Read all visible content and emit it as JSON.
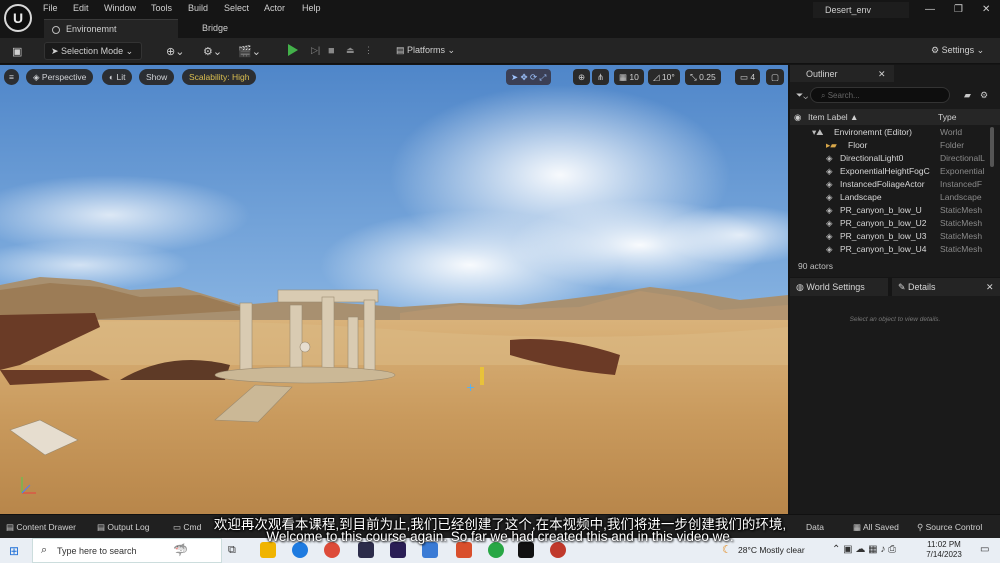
{
  "menubar": {
    "logo": "U",
    "items": [
      "File",
      "Edit",
      "Window",
      "Tools",
      "Build",
      "Select",
      "Actor",
      "Help"
    ],
    "project": "Desert_env"
  },
  "tabs": [
    {
      "label": "Environemnt"
    },
    {
      "label": "Bridge"
    }
  ],
  "toolbar": {
    "selection_mode": "Selection Mode",
    "platforms": "Platforms",
    "settings": "Settings"
  },
  "viewport": {
    "perspective": "Perspective",
    "lit": "Lit",
    "show": "Show",
    "scalability": "Scalability: High",
    "grid_snap": "10",
    "rot_snap": "10°",
    "scale_snap": "0.25",
    "cam_speed": "4"
  },
  "outliner": {
    "title": "Outliner",
    "search_placeholder": "Search...",
    "col_label": "Item Label ▲",
    "col_type": "Type",
    "rows": [
      {
        "label": "Environemnt (Editor)",
        "type": "World",
        "indent": 1
      },
      {
        "label": "Floor",
        "type": "Folder",
        "indent": 2
      },
      {
        "label": "DirectionalLight0",
        "type": "DirectionalL",
        "indent": 2
      },
      {
        "label": "ExponentialHeightFogC",
        "type": "Exponential",
        "indent": 2
      },
      {
        "label": "InstancedFoliageActor",
        "type": "InstancedF",
        "indent": 2
      },
      {
        "label": "Landscape",
        "type": "Landscape",
        "indent": 2
      },
      {
        "label": "PR_canyon_b_low_U",
        "type": "StaticMesh",
        "indent": 2
      },
      {
        "label": "PR_canyon_b_low_U2",
        "type": "StaticMesh",
        "indent": 2
      },
      {
        "label": "PR_canyon_b_low_U3",
        "type": "StaticMesh",
        "indent": 2
      },
      {
        "label": "PR_canyon_b_low_U4",
        "type": "StaticMesh",
        "indent": 2
      }
    ],
    "count": "90 actors"
  },
  "details": {
    "tab_world": "World Settings",
    "tab_details": "Details",
    "empty": "Select an object to view details."
  },
  "statusbar": {
    "content_drawer": "Content Drawer",
    "output_log": "Output Log",
    "cmd": "Cmd",
    "data": "Data",
    "all_saved": "All Saved",
    "source_control": "Source Control"
  },
  "taskbar": {
    "search": "Type here to search",
    "weather": "28°C  Mostly clear",
    "time": "11:02 PM",
    "date": "7/14/2023"
  },
  "subtitles": {
    "cn": "欢迎再次观看本课程,到目前为止,我们已经创建了这个,在本视频中,我们将进一步创建我们的环境,",
    "en": "Welcome to this course again. So far we had created this and in this video we."
  }
}
